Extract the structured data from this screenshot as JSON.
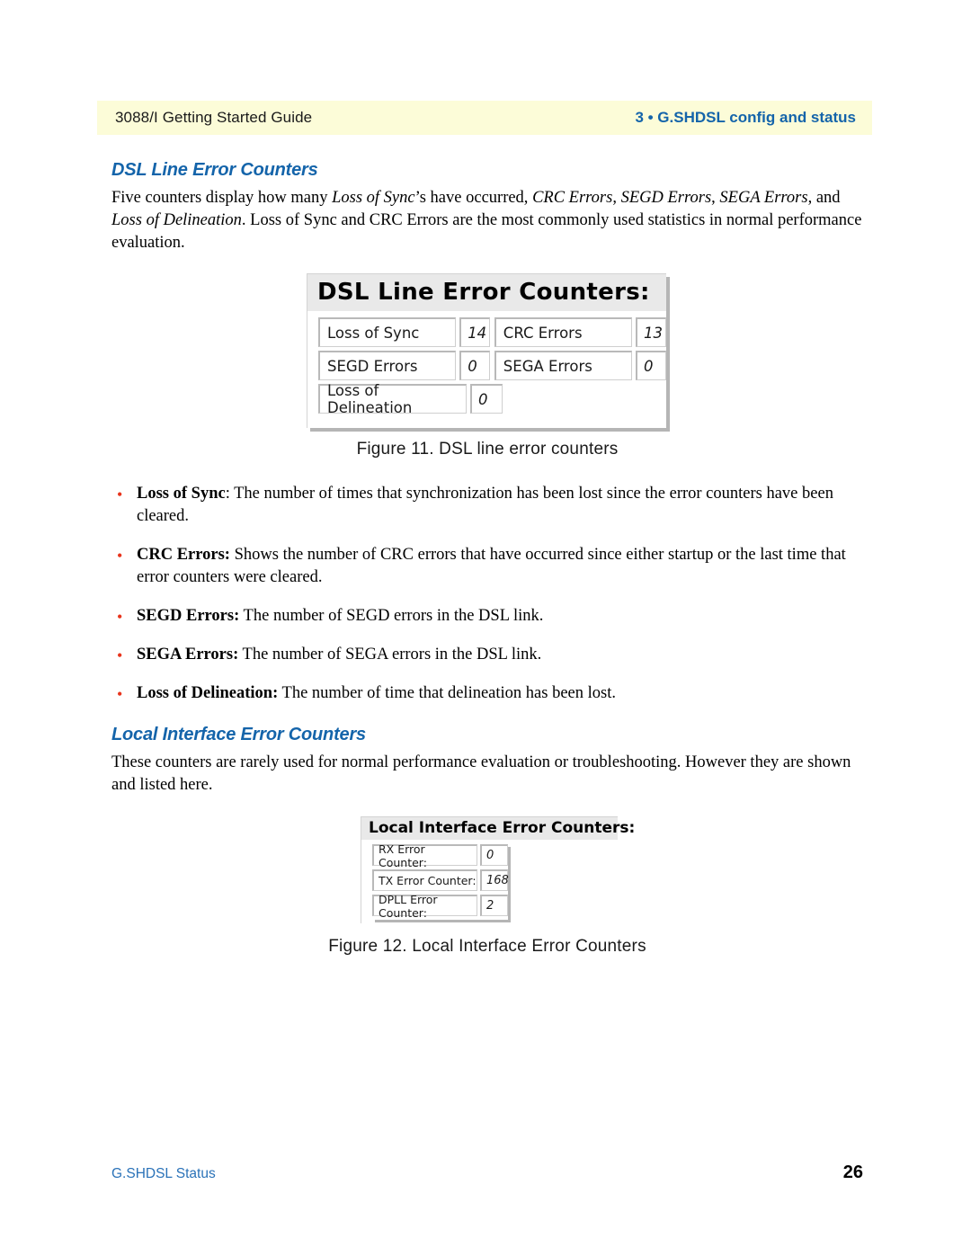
{
  "header": {
    "left_text": "3088/I Getting Started Guide",
    "right_text": "3 • G.SHDSL config and status",
    "band_color": "#fcfcd8",
    "accent_color": "#1464aa"
  },
  "sections": [
    {
      "title": "DSL Line Error Counters",
      "paragraph_html": "Five counters display how many <i>Loss of Sync</i>’s have occurred, <i>CRC Errors</i>, <i>SEGD Errors</i>, <i>SEGA Errors</i>, and <i>Loss of Delineation</i>. Loss of Sync and CRC Errors are the most commonly used statistics in normal performance evaluation."
    },
    {
      "title": "Local Interface Error Counters",
      "paragraph_html": "These counters are rarely used for normal performance evaluation or troubleshooting. However they are shown and listed here."
    }
  ],
  "figure11": {
    "window_title": "DSL Line Error Counters:",
    "rows": [
      {
        "left_label": "Loss of Sync",
        "left_value": "14",
        "right_label": "CRC Errors",
        "right_value": "13"
      },
      {
        "left_label": "SEGD Errors",
        "left_value": "0",
        "right_label": "SEGA Errors",
        "right_value": "0"
      },
      {
        "left_label": "Loss of Delineation",
        "left_value": "0",
        "right_label": "",
        "right_value": ""
      }
    ],
    "caption": "Figure 11. DSL line error counters"
  },
  "figure12": {
    "window_title": "Local Interface Error Counters:",
    "rows": [
      {
        "label": "RX Error Counter:",
        "value": "0"
      },
      {
        "label": "TX Error Counter:",
        "value": "168"
      },
      {
        "label": "DPLL Error Counter:",
        "value": "2"
      }
    ],
    "caption": "Figure 12. Local Interface Error Counters"
  },
  "bullets": {
    "glyph": "•",
    "glyph_color": "#e8341c",
    "items": [
      {
        "term": "Loss of Sync",
        "separator": ":",
        "text": " The number of times that synchronization has been lost since the error counters have been cleared."
      },
      {
        "term": "CRC Errors:",
        "separator": "",
        "text": " Shows the number of CRC errors that have occurred since either startup or the last time that error counters were cleared."
      },
      {
        "term": "SEGD Errors:",
        "separator": "",
        "text": " The number of SEGD errors in the DSL link."
      },
      {
        "term": "SEGA Errors:",
        "separator": "",
        "text": " The number of SEGA errors in the DSL link."
      },
      {
        "term": "Loss of Delineation:",
        "separator": "",
        "text": " The number of time that delineation has been lost."
      }
    ]
  },
  "footer": {
    "left_text": "G.SHDSL Status",
    "page_number": "26"
  }
}
